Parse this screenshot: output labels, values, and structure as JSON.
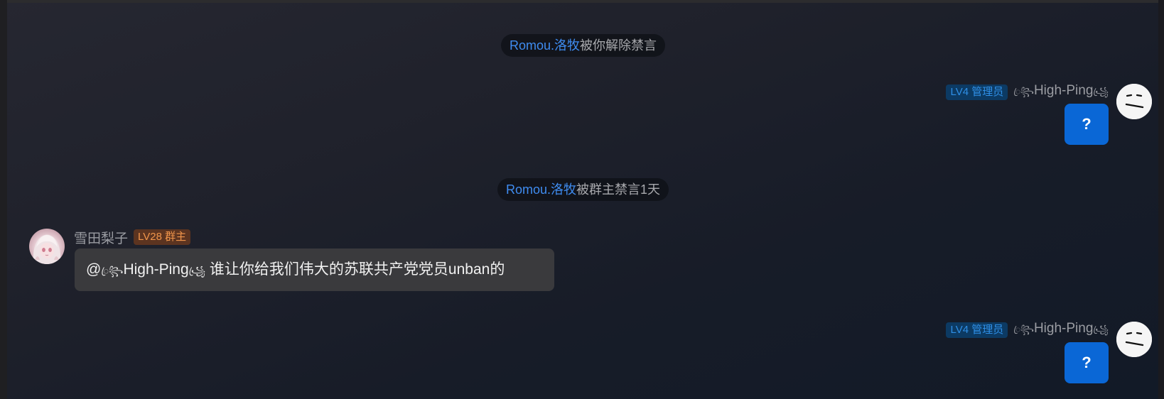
{
  "notices": [
    {
      "user": "Romou.洛牧",
      "text": "被你解除禁言"
    },
    {
      "user": "Romou.洛牧",
      "text": "被群主禁言1天"
    }
  ],
  "messages": [
    {
      "side": "right",
      "badge": "LV4 管理员",
      "deco_left": "ꦿ꧂",
      "nickname": "High-Ping",
      "deco_right": "꧁ꦿ",
      "text": "?",
      "avatar_icon": "meh-face-icon"
    },
    {
      "side": "left",
      "nickname": "雪田梨子",
      "badge": "LV28 群主",
      "mention_prefix": "@",
      "mention_deco_left": "ꦿ꧂",
      "mention_name": "High-Ping",
      "mention_deco_right": "꧁ꦿ",
      "text": "谁让你给我们伟大的苏联共产党党员unban的",
      "avatar_icon": "anime-girl-avatar-icon"
    },
    {
      "side": "right",
      "badge": "LV4 管理员",
      "deco_left": "ꦿ꧂",
      "nickname": "High-Ping",
      "deco_right": "꧁ꦿ",
      "text": "?",
      "avatar_icon": "meh-face-icon"
    }
  ],
  "colors": {
    "link": "#3f8cf0",
    "bubble_self": "#0a67d6",
    "bubble_other": "#3a3a3d",
    "badge_admin_text": "#2f8fe6",
    "badge_owner_text": "#f0954b"
  }
}
